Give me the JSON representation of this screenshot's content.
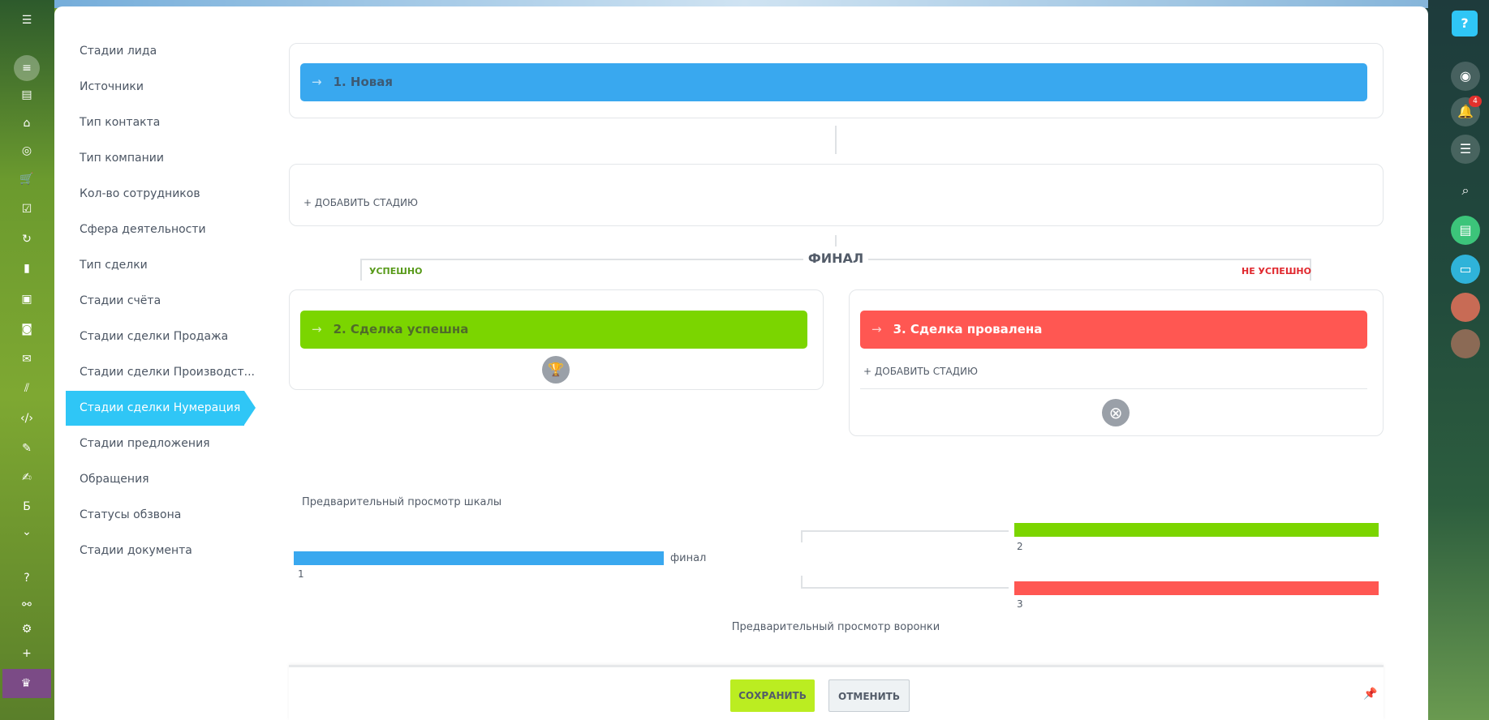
{
  "menu": {
    "items": [
      "Стадии лида",
      "Источники",
      "Тип контакта",
      "Тип компании",
      "Кол-во сотрудников",
      "Сфера деятельности",
      "Тип сделки",
      "Стадии счёта",
      "Стадии сделки Продажа",
      "Стадии сделки Производст...",
      "Стадии сделки Нумерация",
      "Стадии предложения",
      "Обращения",
      "Статусы обзвона",
      "Стадии документа"
    ],
    "active_index": 10
  },
  "stages": {
    "first": {
      "label": "1. Новая",
      "color": "#39a8ef"
    },
    "add_stage": "+ ДОБАВИТЬ СТАДИЮ",
    "final_label": "ФИНАЛ",
    "success_label": "УСПЕШНО",
    "success_color": "#589a1a",
    "fail_label": "НЕ УСПЕШНО",
    "fail_color": "#e0282e",
    "success": {
      "label": "2. Сделка успешна",
      "color": "#7bd500"
    },
    "fail": {
      "label": "3. Сделка провалена",
      "color": "#ff5752"
    },
    "arrow": "→"
  },
  "preview": {
    "scale_title": "Предварительный просмотр шкалы",
    "final": "финал",
    "n1": "1",
    "n2": "2",
    "n3": "3",
    "funnel_title": "Предварительный просмотр воронки"
  },
  "footer": {
    "save": "СОХРАНИТЬ",
    "cancel": "ОТМЕНИТЬ"
  },
  "right_bar": {
    "notifications_count": "4"
  },
  "left_bar": {
    "letter_item": "Б"
  }
}
